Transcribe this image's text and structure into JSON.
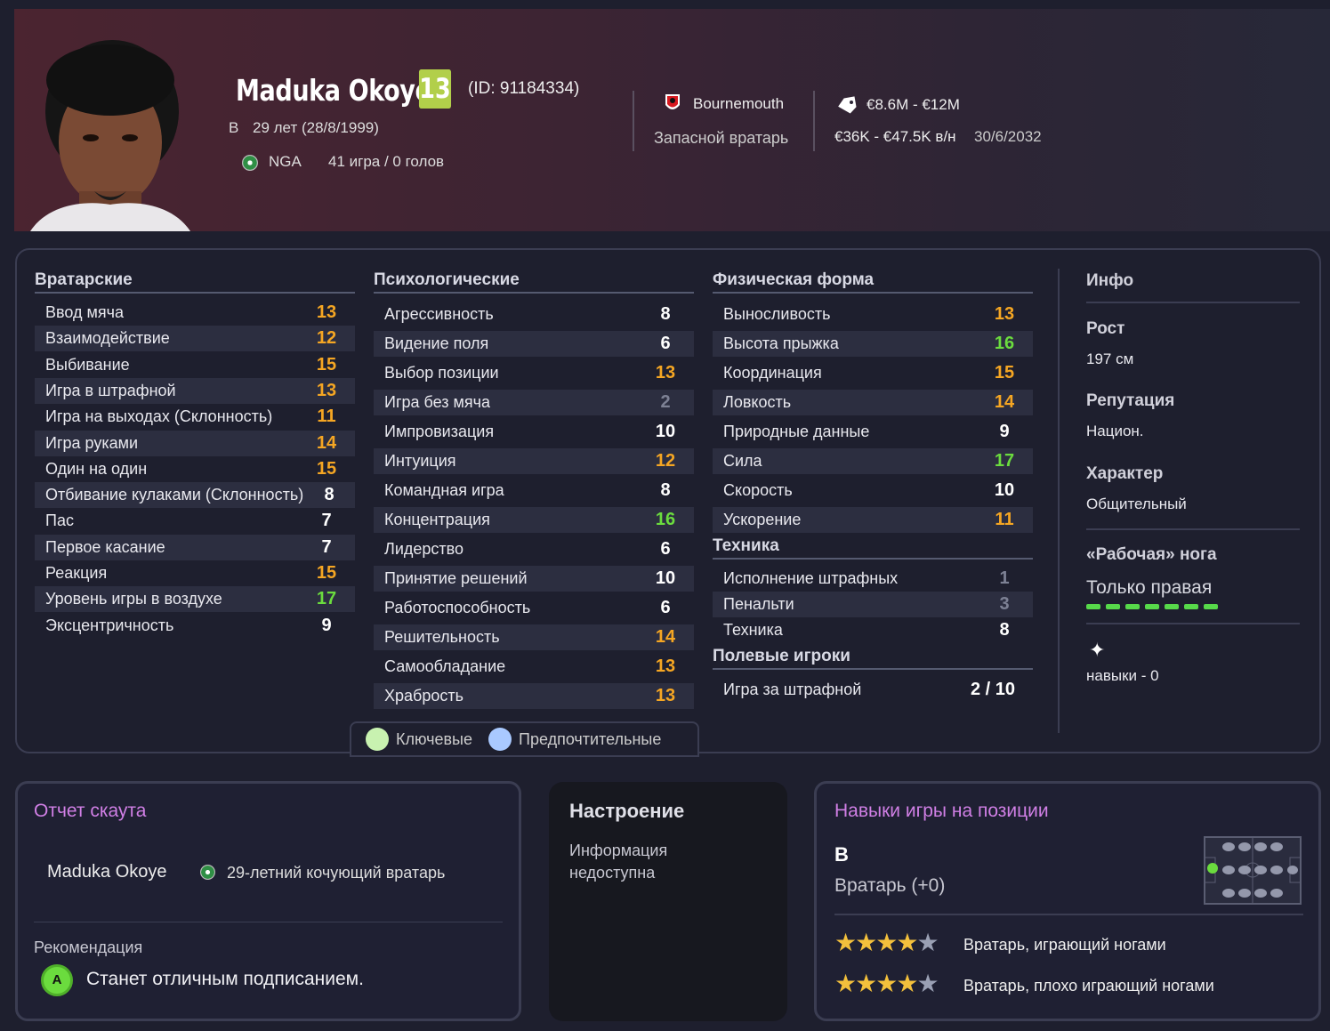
{
  "player": {
    "name": "Maduka Okoye",
    "rating": "13",
    "id": "(ID: 91184334)",
    "position": "В",
    "age": "29 лет (28/8/1999)",
    "nation": "NGA",
    "games": "41 игра / 0 голов",
    "club": "Bournemouth",
    "role": "Запасной вратарь",
    "value": "€8.6M - €12M",
    "wage": "€36K - €47.5K в/н",
    "contract": "30/6/2032"
  },
  "colors": {
    "orange": "#f5a623",
    "green": "#6bdc3e",
    "white": "#ffffff",
    "grey": "#7d8194"
  },
  "goalkeeping": {
    "title": "Вратарские",
    "rows": [
      {
        "label": "Ввод мяча",
        "value": "13",
        "color": "#f5a623"
      },
      {
        "label": "Взаимодействие",
        "value": "12",
        "color": "#f5a623"
      },
      {
        "label": "Выбивание",
        "value": "15",
        "color": "#f5a623"
      },
      {
        "label": "Игра в штрафной",
        "value": "13",
        "color": "#f5a623"
      },
      {
        "label": "Игра на выходах (Склонность)",
        "value": "11",
        "color": "#f5a623"
      },
      {
        "label": "Игра руками",
        "value": "14",
        "color": "#f5a623"
      },
      {
        "label": "Один на один",
        "value": "15",
        "color": "#f5a623"
      },
      {
        "label": "Отбивание кулаками (Склонность)",
        "value": "8",
        "color": "#ffffff"
      },
      {
        "label": "Пас",
        "value": "7",
        "color": "#ffffff"
      },
      {
        "label": "Первое касание",
        "value": "7",
        "color": "#ffffff"
      },
      {
        "label": "Реакция",
        "value": "15",
        "color": "#f5a623"
      },
      {
        "label": "Уровень игры в воздухе",
        "value": "17",
        "color": "#6bdc3e"
      },
      {
        "label": "Эксцентричность",
        "value": "9",
        "color": "#ffffff"
      }
    ]
  },
  "mental": {
    "title": "Психологические",
    "rows": [
      {
        "label": "Агрессивность",
        "value": "8",
        "color": "#ffffff"
      },
      {
        "label": "Видение поля",
        "value": "6",
        "color": "#ffffff"
      },
      {
        "label": "Выбор позиции",
        "value": "13",
        "color": "#f5a623"
      },
      {
        "label": "Игра без мяча",
        "value": "2",
        "color": "#7d8194"
      },
      {
        "label": "Импровизация",
        "value": "10",
        "color": "#ffffff"
      },
      {
        "label": "Интуиция",
        "value": "12",
        "color": "#f5a623"
      },
      {
        "label": "Командная игра",
        "value": "8",
        "color": "#ffffff"
      },
      {
        "label": "Концентрация",
        "value": "16",
        "color": "#6bdc3e"
      },
      {
        "label": "Лидерство",
        "value": "6",
        "color": "#ffffff"
      },
      {
        "label": "Принятие решений",
        "value": "10",
        "color": "#ffffff"
      },
      {
        "label": "Работоспособность",
        "value": "6",
        "color": "#ffffff"
      },
      {
        "label": "Решительность",
        "value": "14",
        "color": "#f5a623"
      },
      {
        "label": "Самообладание",
        "value": "13",
        "color": "#f5a623"
      },
      {
        "label": "Храбрость",
        "value": "13",
        "color": "#f5a623"
      }
    ]
  },
  "physical": {
    "title": "Физическая форма",
    "rows": [
      {
        "label": "Выносливость",
        "value": "13",
        "color": "#f5a623"
      },
      {
        "label": "Высота прыжка",
        "value": "16",
        "color": "#6bdc3e"
      },
      {
        "label": "Координация",
        "value": "15",
        "color": "#f5a623"
      },
      {
        "label": "Ловкость",
        "value": "14",
        "color": "#f5a623"
      },
      {
        "label": "Природные данные",
        "value": "9",
        "color": "#ffffff"
      },
      {
        "label": "Сила",
        "value": "17",
        "color": "#6bdc3e"
      },
      {
        "label": "Скорость",
        "value": "10",
        "color": "#ffffff"
      },
      {
        "label": "Ускорение",
        "value": "11",
        "color": "#f5a623"
      }
    ]
  },
  "technique": {
    "title": "Техника",
    "rows": [
      {
        "label": "Исполнение штрафных",
        "value": "1",
        "color": "#7d8194"
      },
      {
        "label": "Пенальти",
        "value": "3",
        "color": "#7d8194"
      },
      {
        "label": "Техника",
        "value": "8",
        "color": "#ffffff"
      }
    ]
  },
  "outfield": {
    "title": "Полевые игроки",
    "rows": [
      {
        "label": "Игра за штрафной",
        "value": "2 / 10",
        "color": "#ffffff"
      }
    ]
  },
  "legend": {
    "key": "Ключевые",
    "preferred": "Предпочтительные"
  },
  "info": {
    "title": "Инфо",
    "height_label": "Рост",
    "height": "197 см",
    "reputation_label": "Репутация",
    "reputation": "Национ.",
    "character_label": "Характер",
    "character": "Общительный",
    "foot_label": "«Рабочая» нога",
    "foot": "Только правая",
    "foot_level": 1.0,
    "skills": "навыки - 0"
  },
  "scout": {
    "title": "Отчет скаута",
    "name": "Maduka Okoye",
    "desc": "29-летний кочующий вратарь",
    "rec_label": "Рекомендация",
    "grade": "A",
    "rec": "Станет отличным подписанием."
  },
  "mood": {
    "title": "Настроение",
    "text": "Информация недоступна"
  },
  "position_skills": {
    "title": "Навыки игры на позиции",
    "pos": "В",
    "role": "Вратарь (+0)",
    "roles": [
      {
        "name": "Вратарь, играющий ногами",
        "stars": 4
      },
      {
        "name": "Вратарь, плохо играющий ногами",
        "stars": 4
      }
    ]
  }
}
